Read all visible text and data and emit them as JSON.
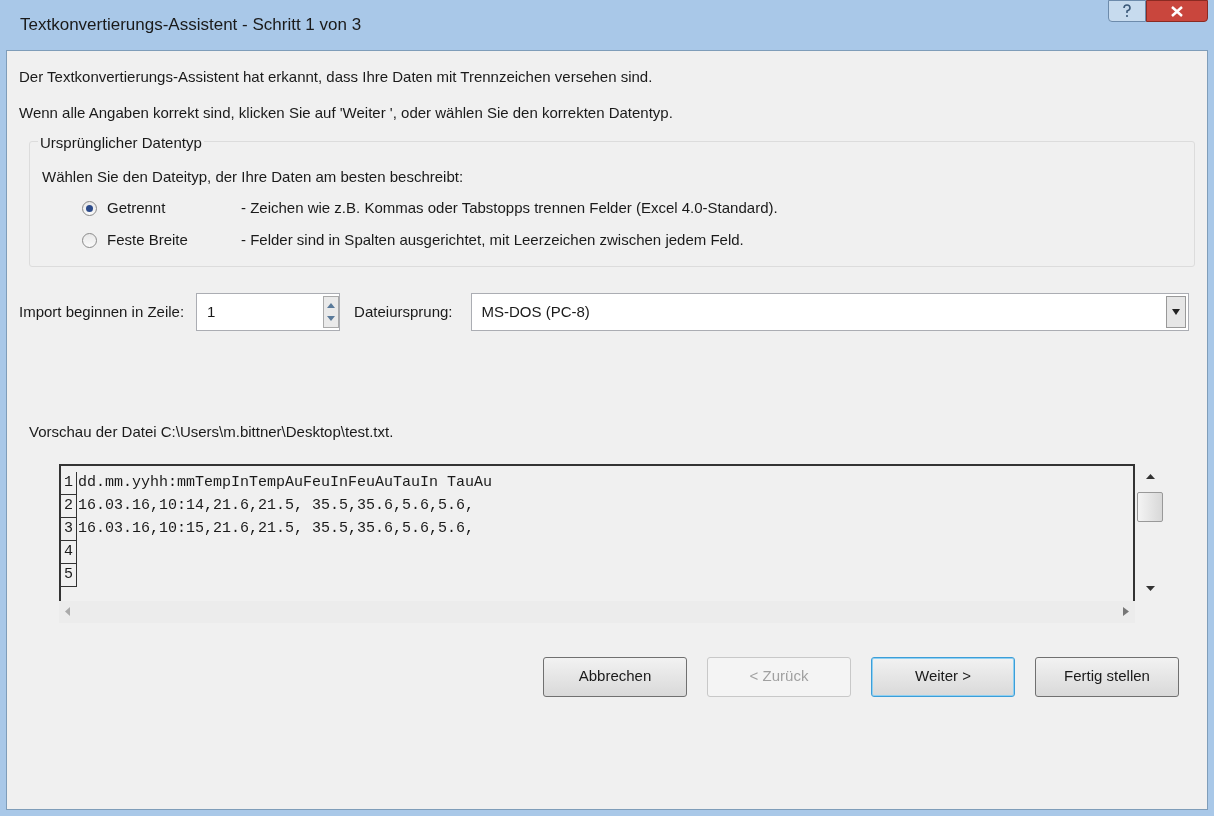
{
  "window": {
    "title": "Textkonvertierungs-Assistent - Schritt 1 von 3"
  },
  "intro": [
    "Der Textkonvertierungs-Assistent hat erkannt, dass Ihre Daten mit Trennzeichen versehen sind.",
    "Wenn alle Angaben korrekt sind, klicken Sie auf 'Weiter ', oder wählen Sie den korrekten Datentyp."
  ],
  "group": {
    "title": "Ursprünglicher Datentyp",
    "prompt": "Wählen Sie den Dateityp, der Ihre Daten am besten beschreibt:",
    "options": [
      {
        "label": "Getrennt",
        "description": "- Zeichen wie z.B. Kommas oder Tabstopps trennen Felder (Excel 4.0-Standard).",
        "selected": true
      },
      {
        "label": "Feste Breite",
        "description": "- Felder sind in Spalten ausgerichtet, mit Leerzeichen zwischen jedem Feld.",
        "selected": false
      }
    ]
  },
  "start_row": {
    "label": "Import beginnen in Zeile:",
    "value": "1"
  },
  "origin": {
    "label": "Dateiursprung:",
    "value": "MS-DOS (PC-8)"
  },
  "preview": {
    "title": "Vorschau der Datei C:\\Users\\m.bittner\\Desktop\\test.txt.",
    "rows": [
      {
        "number": "1",
        "text": "dd.mm.yyhh:mmTempInTempAuFeuInFeuAuTauIn TauAu"
      },
      {
        "number": "2",
        "text": "16.03.16,10:14,21.6,21.5, 35.5,35.6,5.6,5.6,"
      },
      {
        "number": "3",
        "text": "16.03.16,10:15,21.6,21.5, 35.5,35.6,5.6,5.6,"
      },
      {
        "number": "4",
        "text": ""
      },
      {
        "number": "5",
        "text": ""
      }
    ]
  },
  "buttons": [
    {
      "label": "Abbrechen",
      "disabled": false,
      "default": false
    },
    {
      "label": "< Zurück",
      "disabled": true,
      "default": false
    },
    {
      "label": "Weiter >",
      "disabled": false,
      "default": true
    },
    {
      "label": "Fertig stellen",
      "disabled": false,
      "default": false
    }
  ]
}
